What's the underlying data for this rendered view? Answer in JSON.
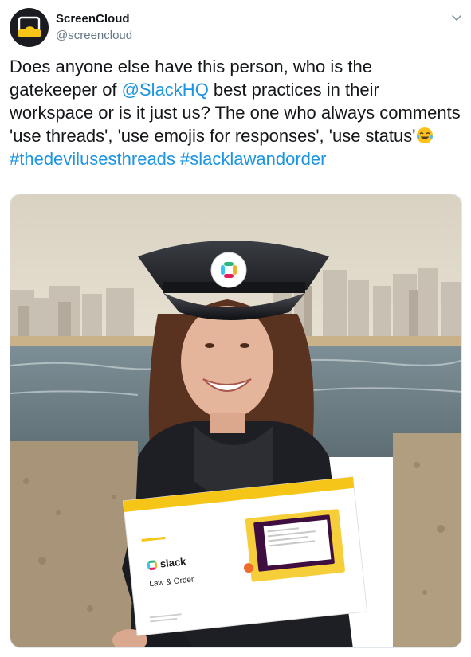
{
  "tweet": {
    "author_name": "ScreenCloud",
    "author_handle": "@screencloud",
    "text_parts": {
      "p1": "Does anyone else have this person, who is the gatekeeper of ",
      "mention": "@SlackHQ",
      "p2": " best practices in their workspace or is it just us? The one who always comments 'use threads', 'use emojis for responses', 'use status'",
      "hashtag1": "#thedevilusesthreads",
      "hashtag2": "#slacklawandorder"
    },
    "icons": {
      "avatar": "screencloud-logo",
      "menu": "chevron-down-icon",
      "emoji": "tears-of-joy-emoji"
    },
    "media": {
      "description_tag": "photo",
      "sign_brand": "slack",
      "sign_title": "Law & Order"
    },
    "colors": {
      "link": "#1b95e0",
      "text": "#14171a",
      "secondary": "#657786",
      "avatar_bg": "#1b1c22",
      "brand_yellow": "#f5c518"
    }
  }
}
